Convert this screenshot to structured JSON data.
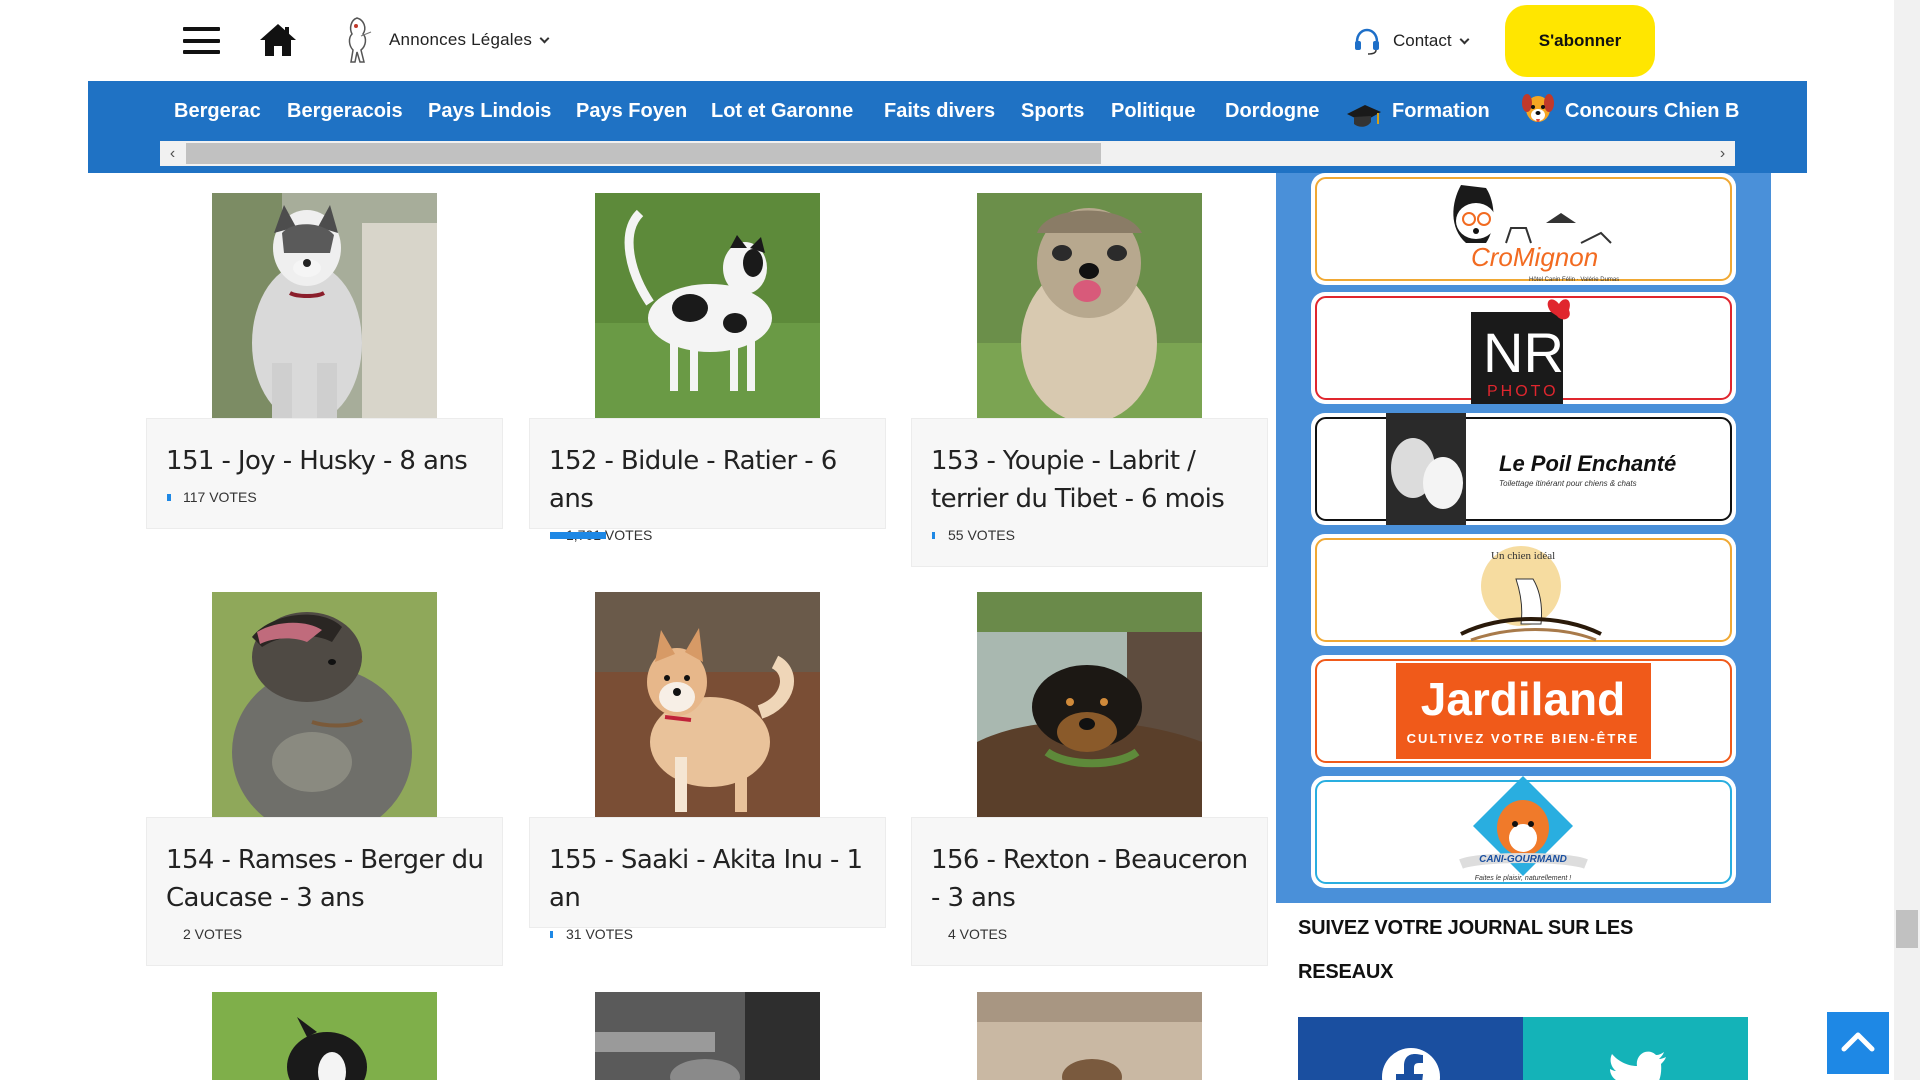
{
  "header": {
    "annonces_label": "Annonces Légales",
    "contact_label": "Contact",
    "subscribe_label": "S'abonner"
  },
  "nav": {
    "items": [
      {
        "label": "Bergerac"
      },
      {
        "label": "Bergeracois"
      },
      {
        "label": "Pays Lindois"
      },
      {
        "label": "Pays Foyen"
      },
      {
        "label": "Lot et Garonne"
      },
      {
        "label": "Faits divers"
      },
      {
        "label": "Sports"
      },
      {
        "label": "Politique"
      },
      {
        "label": "Dordogne"
      },
      {
        "label": "Formation",
        "icon": "graduation-cap-icon"
      },
      {
        "label": "Concours Chien B",
        "icon": "dog-icon"
      }
    ]
  },
  "cards": [
    {
      "title": "151 - Joy - Husky - 8 ans",
      "votes": "117 VOTES",
      "vote_fraction": 0.07
    },
    {
      "title": "152 - Bidule - Ratier - 6 ans",
      "votes": "1,701 VOTES",
      "vote_fraction": 1.0
    },
    {
      "title": "153 - Youpie - Labrit / terrier du Tibet - 6 mois",
      "votes": "55 VOTES",
      "vote_fraction": 0.03
    },
    {
      "title": "154 - Ramses - Berger du Caucase - 3 ans",
      "votes": "2 VOTES",
      "vote_fraction": 0.0
    },
    {
      "title": "155 - Saaki - Akita Inu - 1 an",
      "votes": "31 VOTES",
      "vote_fraction": 0.02
    },
    {
      "title": "156 - Rexton - Beauceron - 3 ans",
      "votes": "4 VOTES",
      "vote_fraction": 0.0
    }
  ],
  "sponsors": [
    {
      "name": "CroMignon",
      "subtitle": "Hôtel Canin Félin · Valérie Dumas",
      "color": "#f0a833"
    },
    {
      "name": "NR",
      "subtitle": "PHOTO",
      "color": "#e0262e"
    },
    {
      "name": "Le Poil Enchanté",
      "subtitle": "Toilettage itinérant pour chiens & chats",
      "color": "#111111"
    },
    {
      "name": "Un chien idéal",
      "subtitle": "",
      "color": "#f0a833"
    },
    {
      "name": "Jardiland",
      "subtitle": "CULTIVEZ VOTRE BIEN-ÊTRE",
      "color": "#f05a1a"
    },
    {
      "name": "CANI-GOURMAND",
      "subtitle": "Faites le plaisir, naturellement !",
      "color": "#29aee0"
    }
  ],
  "follow_label": "SUIVEZ VOTRE JOURNAL SUR LES RESEAUX",
  "social": [
    {
      "name": "facebook-icon",
      "color": "#1a4fa0"
    },
    {
      "name": "twitter-icon",
      "color": "#14b3b8"
    }
  ],
  "colors": {
    "nav_blue": "#1f72c4",
    "sidebar_blue": "#4a90d9",
    "subscribe_yellow": "#ffe600",
    "vote_bar": "#1e88e5"
  }
}
